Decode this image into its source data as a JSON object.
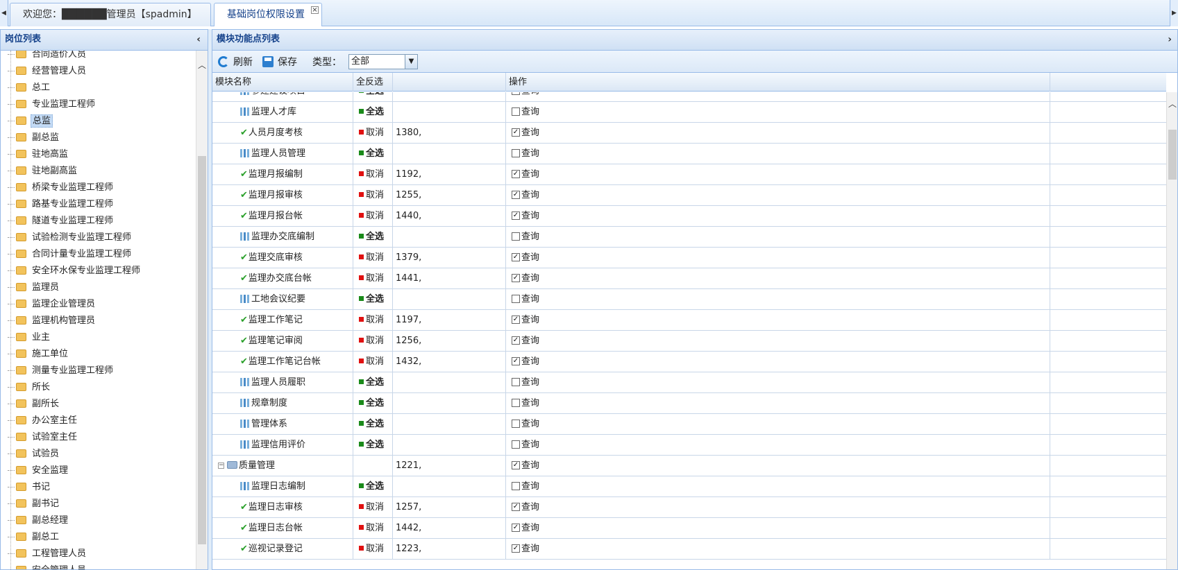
{
  "tabs": {
    "welcome": "欢迎您：██████管理员【spadmin】",
    "permissions": "基础岗位权限设置",
    "close_glyph": "×"
  },
  "left_panel": {
    "title": "岗位列表",
    "collapse_glyph": "‹",
    "items": [
      {
        "label": "合同造价人员",
        "selected": false
      },
      {
        "label": "经营管理人员",
        "selected": false
      },
      {
        "label": "总工",
        "selected": false
      },
      {
        "label": "专业监理工程师",
        "selected": false
      },
      {
        "label": "总监",
        "selected": true
      },
      {
        "label": "副总监",
        "selected": false
      },
      {
        "label": "驻地高监",
        "selected": false
      },
      {
        "label": "驻地副高监",
        "selected": false
      },
      {
        "label": "桥梁专业监理工程师",
        "selected": false
      },
      {
        "label": "路基专业监理工程师",
        "selected": false
      },
      {
        "label": "隧道专业监理工程师",
        "selected": false
      },
      {
        "label": "试验检测专业监理工程师",
        "selected": false
      },
      {
        "label": "合同计量专业监理工程师",
        "selected": false
      },
      {
        "label": "安全环水保专业监理工程师",
        "selected": false
      },
      {
        "label": "监理员",
        "selected": false
      },
      {
        "label": "监理企业管理员",
        "selected": false
      },
      {
        "label": "监理机构管理员",
        "selected": false
      },
      {
        "label": "业主",
        "selected": false
      },
      {
        "label": "施工单位",
        "selected": false
      },
      {
        "label": "测量专业监理工程师",
        "selected": false
      },
      {
        "label": "所长",
        "selected": false
      },
      {
        "label": "副所长",
        "selected": false
      },
      {
        "label": "办公室主任",
        "selected": false
      },
      {
        "label": "试验室主任",
        "selected": false
      },
      {
        "label": "试验员",
        "selected": false
      },
      {
        "label": "安全监理",
        "selected": false
      },
      {
        "label": "书记",
        "selected": false
      },
      {
        "label": "副书记",
        "selected": false
      },
      {
        "label": "副总经理",
        "selected": false
      },
      {
        "label": "副总工",
        "selected": false
      },
      {
        "label": "工程管理人员",
        "selected": false
      },
      {
        "label": "安全管理人员",
        "selected": false
      }
    ]
  },
  "right_panel": {
    "title": "模块功能点列表",
    "expand_glyph": "›",
    "toolbar": {
      "refresh": "刷新",
      "save": "保存",
      "type_label": "类型：",
      "type_value": "全部"
    },
    "columns": {
      "name": "模块名称",
      "select": "全反选",
      "ids": "",
      "operation": "操作"
    },
    "rows": [
      {
        "name": "参建建设项目",
        "kind": "module",
        "sel": "全选",
        "sel_state": "all",
        "ids": "",
        "op": "查询",
        "checked": false
      },
      {
        "name": "监理人才库",
        "kind": "module",
        "sel": "全选",
        "sel_state": "all",
        "ids": "",
        "op": "查询",
        "checked": false
      },
      {
        "name": "人员月度考核",
        "kind": "granted",
        "sel": "取消",
        "sel_state": "cancel",
        "ids": "1380,",
        "op": "查询",
        "checked": true
      },
      {
        "name": "监理人员管理",
        "kind": "module",
        "sel": "全选",
        "sel_state": "all",
        "ids": "",
        "op": "查询",
        "checked": false
      },
      {
        "name": "监理月报编制",
        "kind": "granted",
        "sel": "取消",
        "sel_state": "cancel",
        "ids": "1192,",
        "op": "查询",
        "checked": true
      },
      {
        "name": "监理月报审核",
        "kind": "granted",
        "sel": "取消",
        "sel_state": "cancel",
        "ids": "1255,",
        "op": "查询",
        "checked": true
      },
      {
        "name": "监理月报台帐",
        "kind": "granted",
        "sel": "取消",
        "sel_state": "cancel",
        "ids": "1440,",
        "op": "查询",
        "checked": true
      },
      {
        "name": "监理办交底编制",
        "kind": "module",
        "sel": "全选",
        "sel_state": "all",
        "ids": "",
        "op": "查询",
        "checked": false
      },
      {
        "name": "监理交底审核",
        "kind": "granted",
        "sel": "取消",
        "sel_state": "cancel",
        "ids": "1379,",
        "op": "查询",
        "checked": true
      },
      {
        "name": "监理办交底台帐",
        "kind": "granted",
        "sel": "取消",
        "sel_state": "cancel",
        "ids": "1441,",
        "op": "查询",
        "checked": true
      },
      {
        "name": "工地会议纪要",
        "kind": "module",
        "sel": "全选",
        "sel_state": "all",
        "ids": "",
        "op": "查询",
        "checked": false
      },
      {
        "name": "监理工作笔记",
        "kind": "granted",
        "sel": "取消",
        "sel_state": "cancel",
        "ids": "1197,",
        "op": "查询",
        "checked": true
      },
      {
        "name": "监理笔记审阅",
        "kind": "granted",
        "sel": "取消",
        "sel_state": "cancel",
        "ids": "1256,",
        "op": "查询",
        "checked": true
      },
      {
        "name": "监理工作笔记台帐",
        "kind": "granted",
        "sel": "取消",
        "sel_state": "cancel",
        "ids": "1432,",
        "op": "查询",
        "checked": true
      },
      {
        "name": "监理人员履职",
        "kind": "module",
        "sel": "全选",
        "sel_state": "all",
        "ids": "",
        "op": "查询",
        "checked": false
      },
      {
        "name": "规章制度",
        "kind": "module",
        "sel": "全选",
        "sel_state": "all",
        "ids": "",
        "op": "查询",
        "checked": false
      },
      {
        "name": "管理体系",
        "kind": "module",
        "sel": "全选",
        "sel_state": "all",
        "ids": "",
        "op": "查询",
        "checked": false
      },
      {
        "name": "监理信用评价",
        "kind": "module",
        "sel": "全选",
        "sel_state": "all",
        "ids": "",
        "op": "查询",
        "checked": false
      },
      {
        "name": "质量管理",
        "kind": "group",
        "sel": "",
        "sel_state": "none",
        "ids": "1221,",
        "op": "查询",
        "checked": true
      },
      {
        "name": "监理日志编制",
        "kind": "module",
        "sel": "全选",
        "sel_state": "all",
        "ids": "",
        "op": "查询",
        "checked": false
      },
      {
        "name": "监理日志审核",
        "kind": "granted",
        "sel": "取消",
        "sel_state": "cancel",
        "ids": "1257,",
        "op": "查询",
        "checked": true
      },
      {
        "name": "监理日志台帐",
        "kind": "granted",
        "sel": "取消",
        "sel_state": "cancel",
        "ids": "1442,",
        "op": "查询",
        "checked": true
      },
      {
        "name": "巡视记录登记",
        "kind": "granted",
        "sel": "取消",
        "sel_state": "cancel",
        "ids": "1223,",
        "op": "查询",
        "checked": true
      }
    ]
  }
}
